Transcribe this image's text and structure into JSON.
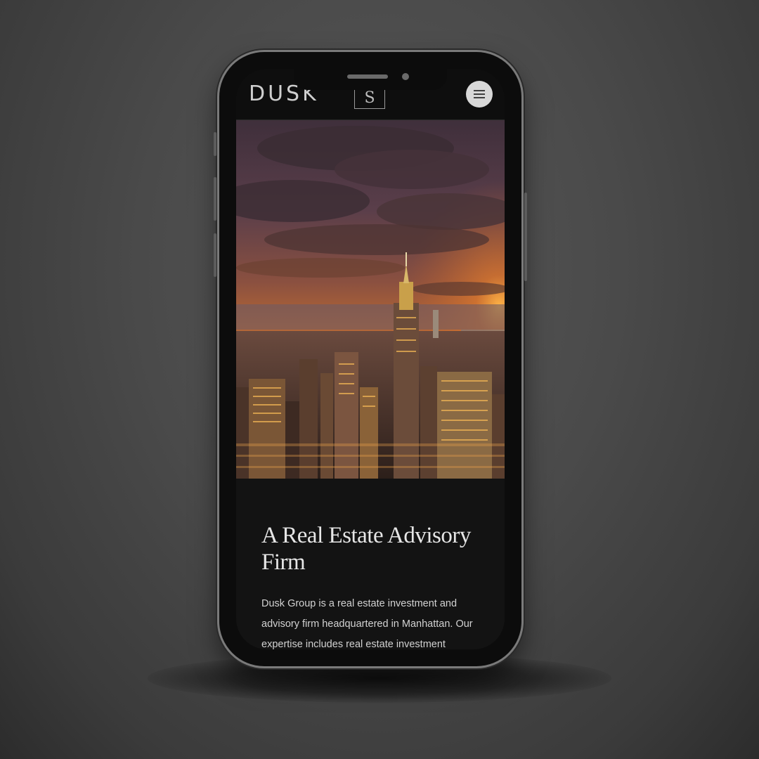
{
  "header": {
    "brand": "DUSK",
    "logo_letter": "S",
    "menu_icon": "hamburger-menu-icon"
  },
  "hero": {
    "image": "sunset-city-skyline"
  },
  "content": {
    "heading": "A Real Estate Advisory Firm",
    "body": "Dusk Group is a real estate investment and advisory firm headquartered in Manhattan. Our expertise includes real estate investment"
  },
  "colors": {
    "background": "#4a4a4a",
    "screen": "#131313",
    "header": "#0e0e0e",
    "text": "#e6e6e6",
    "menu_button": "#d8d8d8"
  }
}
